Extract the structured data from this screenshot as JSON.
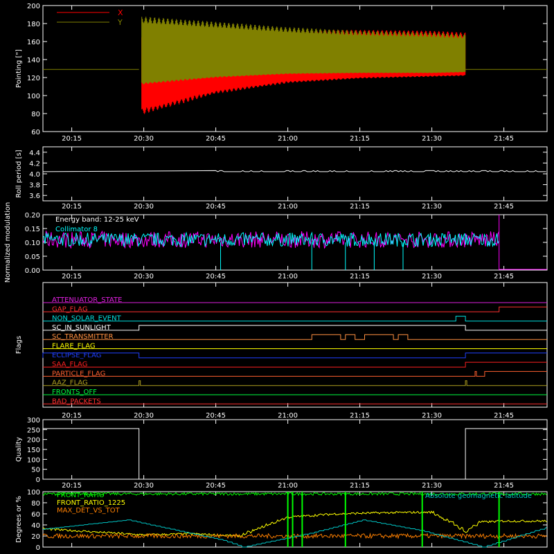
{
  "colors": {
    "background": "#000000",
    "axes": "#ffffff",
    "x_series": "#ff0000",
    "y_series": "#808000",
    "roll": "#ffffff",
    "collimator": "#00ffff",
    "collimator_alt": "#ff00ff",
    "quality": "#ffffff",
    "front_ratio": "#00ff00",
    "front_ratio_1225": "#ffff00",
    "max_det_vs_tot": "#ff8000",
    "geomagnetic": "#00c8c8"
  },
  "time_axis": {
    "ticks": [
      "20:15",
      "20:30",
      "20:45",
      "21:00",
      "21:15",
      "21:30",
      "21:45"
    ],
    "range": [
      "20:09",
      "21:54"
    ]
  },
  "chart_data": [
    {
      "type": "line",
      "ylabel": "Pointing [\"]",
      "ylim": [
        60,
        200
      ],
      "yticks": [
        "60",
        "80",
        "100",
        "120",
        "140",
        "160",
        "180",
        "200"
      ],
      "legend": "top-left",
      "series": [
        {
          "name": "X",
          "color": "#ff0000",
          "x": [
            "20:09",
            "20:29",
            "20:29",
            "20:45",
            "21:00",
            "21:15",
            "21:30",
            "21:37",
            "21:37",
            "21:54"
          ],
          "y_upper": [
            129,
            129,
            165,
            168,
            172,
            173,
            172,
            170,
            129,
            129
          ],
          "y_lower": [
            129,
            129,
            78,
            102,
            114,
            119,
            121,
            122,
            129,
            129
          ]
        },
        {
          "name": "Y",
          "color": "#808000",
          "x": [
            "20:09",
            "20:29",
            "20:29",
            "20:45",
            "21:00",
            "21:15",
            "21:30",
            "21:37",
            "21:37",
            "21:54"
          ],
          "y_upper": [
            129,
            129,
            188,
            182,
            176,
            172,
            170,
            168,
            129,
            129
          ],
          "y_lower": [
            129,
            129,
            112,
            120,
            124,
            125,
            125,
            126,
            129,
            129
          ]
        }
      ]
    },
    {
      "type": "line",
      "ylabel": "Roll period [s]",
      "ylim": [
        3.5,
        4.5
      ],
      "yticks": [
        "3.6",
        "3.8",
        "4.0",
        "4.2",
        "4.4"
      ],
      "series": [
        {
          "x": [
            "20:09",
            "20:45",
            "21:54"
          ],
          "y": [
            4.04,
            4.04,
            4.04
          ]
        }
      ]
    },
    {
      "type": "line",
      "ylabel": "Normalized modulation",
      "ylim": [
        0,
        0.2
      ],
      "yticks": [
        "0.00",
        "0.05",
        "0.10",
        "0.15",
        "0.20"
      ],
      "annotations": [
        "Energy band: 12-25 keV",
        "Collimator 8"
      ],
      "series": [
        {
          "name": "Collimator 8",
          "color": "#00ffff",
          "x": [
            "20:09",
            "21:44"
          ],
          "y_mean": [
            0.11,
            0.11
          ],
          "dropouts": [
            "20:46",
            "21:05",
            "21:12",
            "21:18",
            "21:24"
          ]
        }
      ]
    },
    {
      "type": "table",
      "ylabel": "Flags",
      "flags": [
        {
          "label": "ATTENUATOR_STATE",
          "color": "#e020e0",
          "high": []
        },
        {
          "label": "GAP_FLAG",
          "color": "#ff3030",
          "high": [
            [
              "21:44",
              "21:54"
            ]
          ]
        },
        {
          "label": "NON_SOLAR_EVENT",
          "color": "#00e0e0",
          "high": [
            [
              "21:35",
              "21:37"
            ]
          ]
        },
        {
          "label": "SC_IN_SUNLIGHT",
          "color": "#ffffff",
          "high": [
            [
              "20:29",
              "21:37"
            ]
          ]
        },
        {
          "label": "SC_TRANSMITTER",
          "color": "#ff9040",
          "high": [
            [
              "21:05",
              "21:11"
            ],
            [
              "21:12",
              "21:14"
            ],
            [
              "21:16",
              "21:22"
            ],
            [
              "21:23",
              "21:25"
            ]
          ]
        },
        {
          "label": "FLARE_FLAG",
          "color": "#ffff00",
          "high": []
        },
        {
          "label": "ECLIPSE_FLAG",
          "color": "#2040ff",
          "high": [
            [
              "20:09",
              "20:29"
            ],
            [
              "21:37",
              "21:54"
            ]
          ]
        },
        {
          "label": "SAA_FLAG",
          "color": "#ff2020",
          "high": [
            [
              "21:37",
              "21:54"
            ]
          ]
        },
        {
          "label": "PARTICLE_FLAG",
          "color": "#ff6030",
          "high": [
            [
              "21:39",
              "21:39"
            ],
            [
              "21:41",
              "21:54"
            ]
          ]
        },
        {
          "label": "AAZ_FLAG",
          "color": "#b0a020",
          "high": [
            [
              "20:29",
              "20:29"
            ],
            [
              "21:37",
              "21:37"
            ]
          ]
        },
        {
          "label": "FRONTS_OFF",
          "color": "#00ff40",
          "high": []
        },
        {
          "label": "BAD_PACKETS",
          "color": "#ff3030",
          "high": []
        }
      ]
    },
    {
      "type": "line",
      "ylabel": "Quality",
      "ylim": [
        0,
        300
      ],
      "yticks": [
        "0",
        "50",
        "100",
        "150",
        "200",
        "250",
        "300"
      ],
      "series": [
        {
          "x": [
            "20:09",
            "20:29",
            "20:29",
            "21:37",
            "21:37",
            "21:54"
          ],
          "y": [
            255,
            255,
            0,
            0,
            255,
            255
          ]
        }
      ]
    },
    {
      "type": "line",
      "ylabel": "Degrees or %",
      "ylim": [
        0,
        100
      ],
      "yticks": [
        "0",
        "20",
        "40",
        "60",
        "80",
        "100"
      ],
      "legend": "top-left",
      "series": [
        {
          "name": "FRONT_RATIO",
          "color": "#00ff00",
          "x": [
            "20:09",
            "21:54"
          ],
          "y": [
            96,
            96
          ]
        },
        {
          "name": "FRONT_RATIO_1225",
          "color": "#ffff00",
          "x": [
            "20:09",
            "20:30",
            "20:40",
            "20:50",
            "21:00",
            "21:10",
            "21:20",
            "21:30",
            "21:35",
            "21:37",
            "21:40",
            "21:45"
          ],
          "y": [
            33,
            22,
            24,
            20,
            54,
            60,
            62,
            63,
            40,
            28,
            45,
            47
          ]
        },
        {
          "name": "MAX_DET_VS_TOT",
          "color": "#ff8000",
          "x": [
            "20:09",
            "21:54"
          ],
          "y": [
            20,
            20
          ]
        },
        {
          "name": "Absolute geomagnetic latitude",
          "color": "#00c8c8",
          "x": [
            "20:09",
            "20:27",
            "20:47",
            "20:51",
            "21:05",
            "21:16",
            "21:28",
            "21:41",
            "21:54"
          ],
          "y": [
            32,
            49,
            12,
            0,
            25,
            49,
            30,
            0,
            35
          ]
        }
      ]
    }
  ]
}
